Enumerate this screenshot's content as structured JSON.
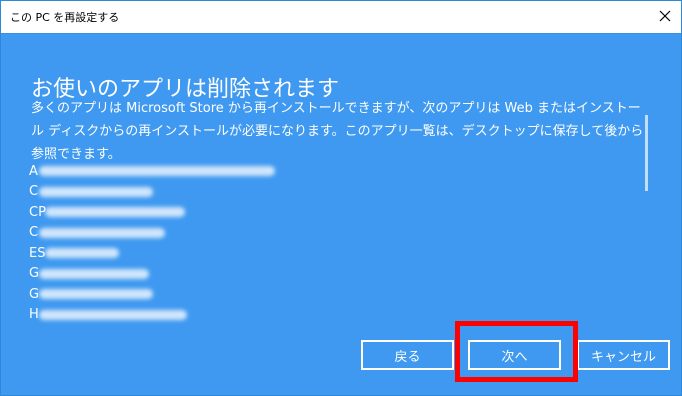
{
  "window": {
    "title": "この PC を再設定する"
  },
  "main": {
    "heading": "お使いのアプリは削除されます",
    "description": "多くのアプリは Microsoft Store から再インストールできますが、次のアプリは Web またはインストール ディスクからの再インストールが必要になります。このアプリ一覧は、デスクトップに保存して後から参照できます。",
    "apps": [
      {
        "initial": "A"
      },
      {
        "initial": "C"
      },
      {
        "initial": "CP"
      },
      {
        "initial": "C"
      },
      {
        "initial": "ES"
      },
      {
        "initial": "G"
      },
      {
        "initial": "G"
      },
      {
        "initial": "H"
      }
    ]
  },
  "buttons": {
    "back": "戻る",
    "next": "次へ",
    "cancel": "キャンセル"
  },
  "colors": {
    "dialog_background": "#3f99f0",
    "titlebar_background": "#ffffff",
    "text": "#ffffff",
    "highlight": "#ff0000"
  },
  "icons": [
    "close-icon"
  ]
}
